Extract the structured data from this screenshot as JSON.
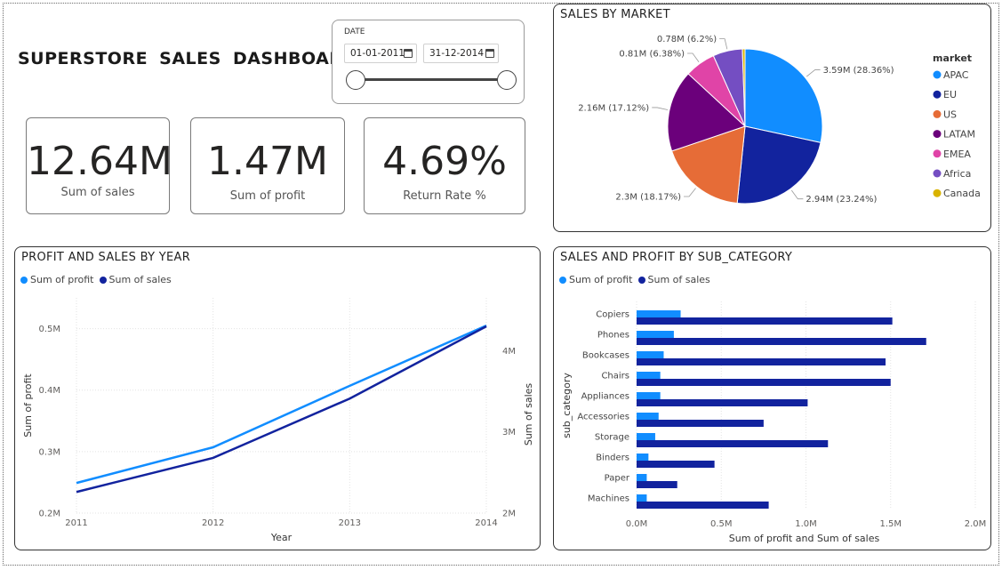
{
  "dashboard": {
    "title": "SUPERSTORE SALES DASHBOARD"
  },
  "slicer": {
    "label": "DATE",
    "start": "01-01-2011",
    "end": "31-12-2014"
  },
  "kpis": [
    {
      "value": "12.64M",
      "label": "Sum of sales"
    },
    {
      "value": "1.47M",
      "label": "Sum of profit"
    },
    {
      "value": "4.69%",
      "label": "Return Rate %"
    }
  ],
  "chart_data": [
    {
      "type": "pie",
      "title": "SALES BY MARKET",
      "legend_title": "market",
      "legend_position": "right",
      "slices": [
        {
          "label": "APAC",
          "value": 3.59,
          "display": "3.59M (28.36%)",
          "color": "#118DFF"
        },
        {
          "label": "EU",
          "value": 2.94,
          "display": "2.94M (23.24%)",
          "color": "#12239E"
        },
        {
          "label": "US",
          "value": 2.3,
          "display": "2.3M (18.17%)",
          "color": "#E66C37"
        },
        {
          "label": "LATAM",
          "value": 2.16,
          "display": "2.16M (17.12%)",
          "color": "#6B007B"
        },
        {
          "label": "EMEA",
          "value": 0.81,
          "display": "0.81M (6.38%)",
          "color": "#E044A7"
        },
        {
          "label": "Africa",
          "value": 0.78,
          "display": "0.78M (6.2%)",
          "color": "#744EC2"
        },
        {
          "label": "Canada",
          "value": 0.07,
          "display": "",
          "color": "#D9B300"
        }
      ]
    },
    {
      "type": "line",
      "title": "PROFIT AND SALES BY YEAR",
      "xlabel": "Year",
      "ylabel": "Sum of profit",
      "y2label": "Sum of sales",
      "x": [
        "2011",
        "2012",
        "2013",
        "2014"
      ],
      "ylim": [
        0.2,
        0.55
      ],
      "y2lim": [
        2.0,
        4.65
      ],
      "yticks": [
        "0.2M",
        "0.3M",
        "0.4M",
        "0.5M"
      ],
      "yticks_values": [
        0.2,
        0.3,
        0.4,
        0.5
      ],
      "y2ticks": [
        "2M",
        "3M",
        "4M"
      ],
      "y2ticks_values": [
        2,
        3,
        4
      ],
      "grid": true,
      "legend_position": "top-left",
      "series": [
        {
          "name": "Sum of profit",
          "axis": "left",
          "values": [
            0.249,
            0.307,
            0.407,
            0.505
          ],
          "color": "#118DFF"
        },
        {
          "name": "Sum of sales",
          "axis": "right",
          "values": [
            2.26,
            2.68,
            3.41,
            4.3
          ],
          "color": "#12239E"
        }
      ]
    },
    {
      "type": "bar",
      "orientation": "horizontal",
      "title": "SALES AND PROFIT BY SUB_CATEGORY",
      "xlabel": "Sum of profit and Sum of sales",
      "ylabel": "sub_category",
      "xlim": [
        0,
        2.0
      ],
      "xticks": [
        "0.0M",
        "0.5M",
        "1.0M",
        "1.5M",
        "2.0M"
      ],
      "xticks_values": [
        0,
        0.5,
        1.0,
        1.5,
        2.0
      ],
      "grid": true,
      "legend_position": "top-left",
      "categories": [
        "Copiers",
        "Phones",
        "Bookcases",
        "Chairs",
        "Appliances",
        "Accessories",
        "Storage",
        "Binders",
        "Paper",
        "Machines"
      ],
      "series": [
        {
          "name": "Sum of profit",
          "values": [
            0.26,
            0.22,
            0.16,
            0.14,
            0.14,
            0.13,
            0.11,
            0.07,
            0.06,
            0.06
          ],
          "color": "#118DFF"
        },
        {
          "name": "Sum of sales",
          "values": [
            1.51,
            1.71,
            1.47,
            1.5,
            1.01,
            0.75,
            1.13,
            0.46,
            0.24,
            0.78
          ],
          "color": "#12239E"
        }
      ]
    }
  ]
}
